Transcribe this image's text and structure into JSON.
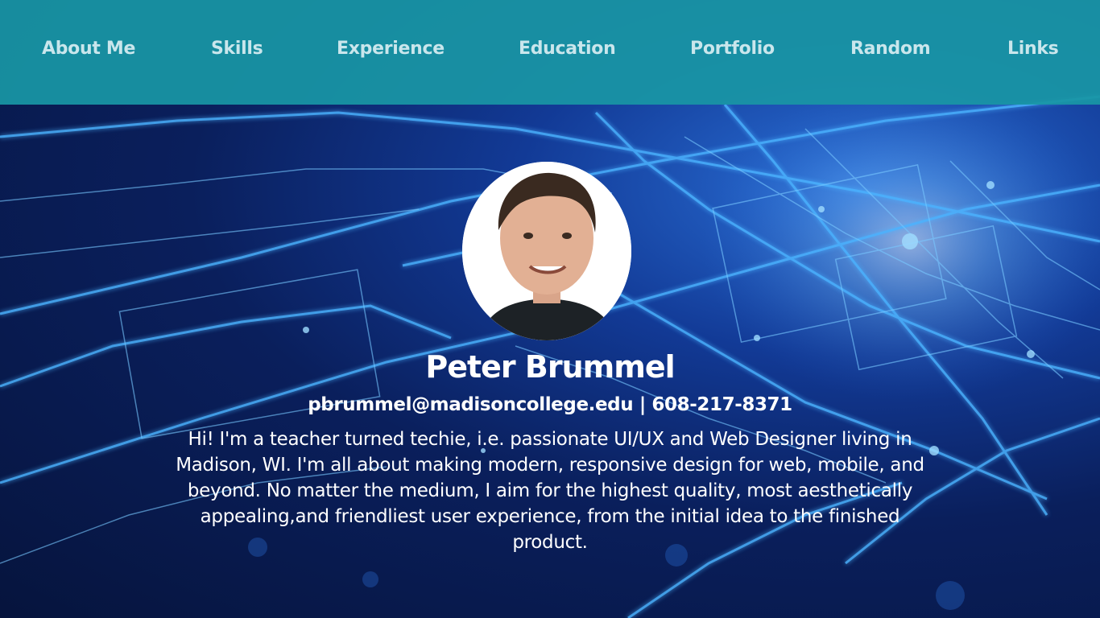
{
  "nav": {
    "items": [
      {
        "label": "About Me"
      },
      {
        "label": "Skills"
      },
      {
        "label": "Experience"
      },
      {
        "label": "Education"
      },
      {
        "label": "Portfolio"
      },
      {
        "label": "Random"
      },
      {
        "label": "Links"
      }
    ]
  },
  "profile": {
    "name": "Peter Brummel",
    "contact": "pbrummel@madisoncollege.edu | 608-217-8371",
    "bio": "Hi! I'm a teacher turned techie, i.e. passionate UI/UX and Web Designer living in Madison, WI. I'm all about making modern, responsive design for web, mobile, and beyond. No matter the medium, I aim for the highest quality, most aesthetically appealing,and friendliest user experience, from the initial idea to the finished product."
  },
  "colors": {
    "navbar": "#1996a5",
    "nav_text": "#c9e6ec",
    "background_dark": "#06143d",
    "circuit_glow": "#3fa8ff",
    "text": "#ffffff"
  }
}
